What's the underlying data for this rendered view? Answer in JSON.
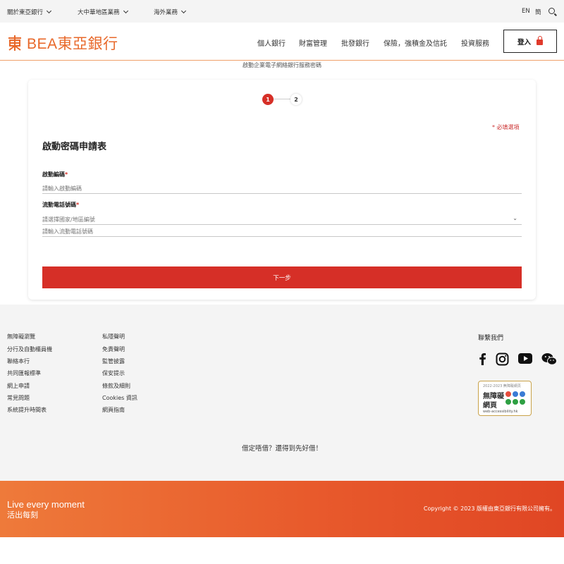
{
  "topbar": {
    "links": [
      "關於東亞銀行",
      "大中華地區業務",
      "海外業務"
    ],
    "lang_en": "EN",
    "lang_sc": "簡"
  },
  "header": {
    "brand": "BEA東亞銀行",
    "nav": [
      "個人銀行",
      "財富管理",
      "批發銀行",
      "保險，強積金及信託",
      "投資服務"
    ],
    "login_label": "登入"
  },
  "page": {
    "subtitle": "啟動企業電子網絡銀行服務密碼"
  },
  "form": {
    "steps": [
      "1",
      "2"
    ],
    "current_step": 1,
    "required_note": "* 必填選項",
    "title": "啟動密碼申請表",
    "activation_code": {
      "label": "啟動編碼",
      "required_mark": "*",
      "placeholder": "請輸入啟動編碼"
    },
    "mobile": {
      "label": "流動電話號碼",
      "required_mark": "*",
      "country_placeholder": "請選擇國家/地區編號",
      "number_placeholder": "請輸入流動電話號碼"
    },
    "next_label": "下一步"
  },
  "footer": {
    "col1": [
      "無障礙瀏覽",
      "分行及自動櫃員機",
      "聯絡本行",
      "共同匯報標準",
      "網上申請",
      "常見問題",
      "系統提升時間表"
    ],
    "col2": [
      "私隱聲明",
      "免責聲明",
      "監管披露",
      "保安提示",
      "條款及細則",
      "Cookies 資訊",
      "網頁指南"
    ],
    "contact_title": "聯繫我們",
    "social_icons": [
      "facebook-icon",
      "instagram-icon",
      "youtube-icon",
      "wechat-icon"
    ],
    "badge": {
      "years": "2022-2023 無障礙網頁",
      "line1": "無障礙",
      "line2": "網頁",
      "url": "web-accessibility.hk"
    },
    "slogan": "借定唔借？還得到先好借！",
    "tagline_en": "Live every moment",
    "tagline_zh": "活出每刻",
    "copyright": "Copyright © 2023 版權由東亞銀行有限公司擁有。"
  },
  "colors": {
    "brand_orange": "#e8682a",
    "primary_red": "#d62f27",
    "footer_bg": "#f4f4f4"
  }
}
